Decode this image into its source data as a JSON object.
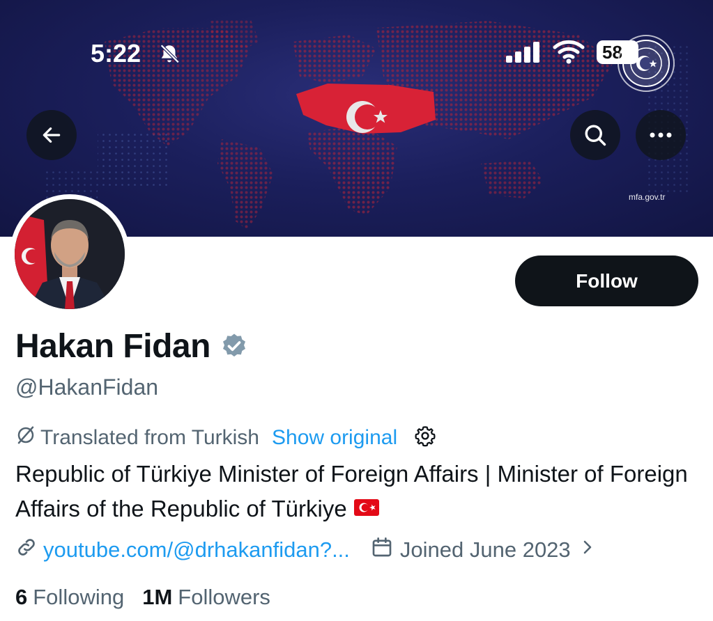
{
  "status_bar": {
    "time": "5:22",
    "battery": "58"
  },
  "banner": {
    "credit": "mfa.gov.tr",
    "background_color": "#1b1f5c",
    "map_color": "#b3263a"
  },
  "nav": {
    "back_icon": "arrow-left-icon",
    "search_icon": "search-icon",
    "more_icon": "more-horizontal-icon"
  },
  "profile": {
    "follow_label": "Follow",
    "name": "Hakan Fidan",
    "handle": "@HakanFidan",
    "translated_label": "Translated from Turkish",
    "show_original_label": "Show original",
    "bio": "Republic of Türkiye Minister of Foreign Affairs | Minister of Foreign Affairs of the Republic of Türkiye",
    "link": "youtube.com/@drhakanfidan?...",
    "joined": "Joined June 2023",
    "following_count": "6",
    "following_label": "Following",
    "followers_count": "1M",
    "followers_label": "Followers"
  },
  "colors": {
    "accent": "#1d9bf0",
    "text_primary": "#0f1419",
    "text_secondary": "#536471",
    "verified": "#829aab"
  }
}
